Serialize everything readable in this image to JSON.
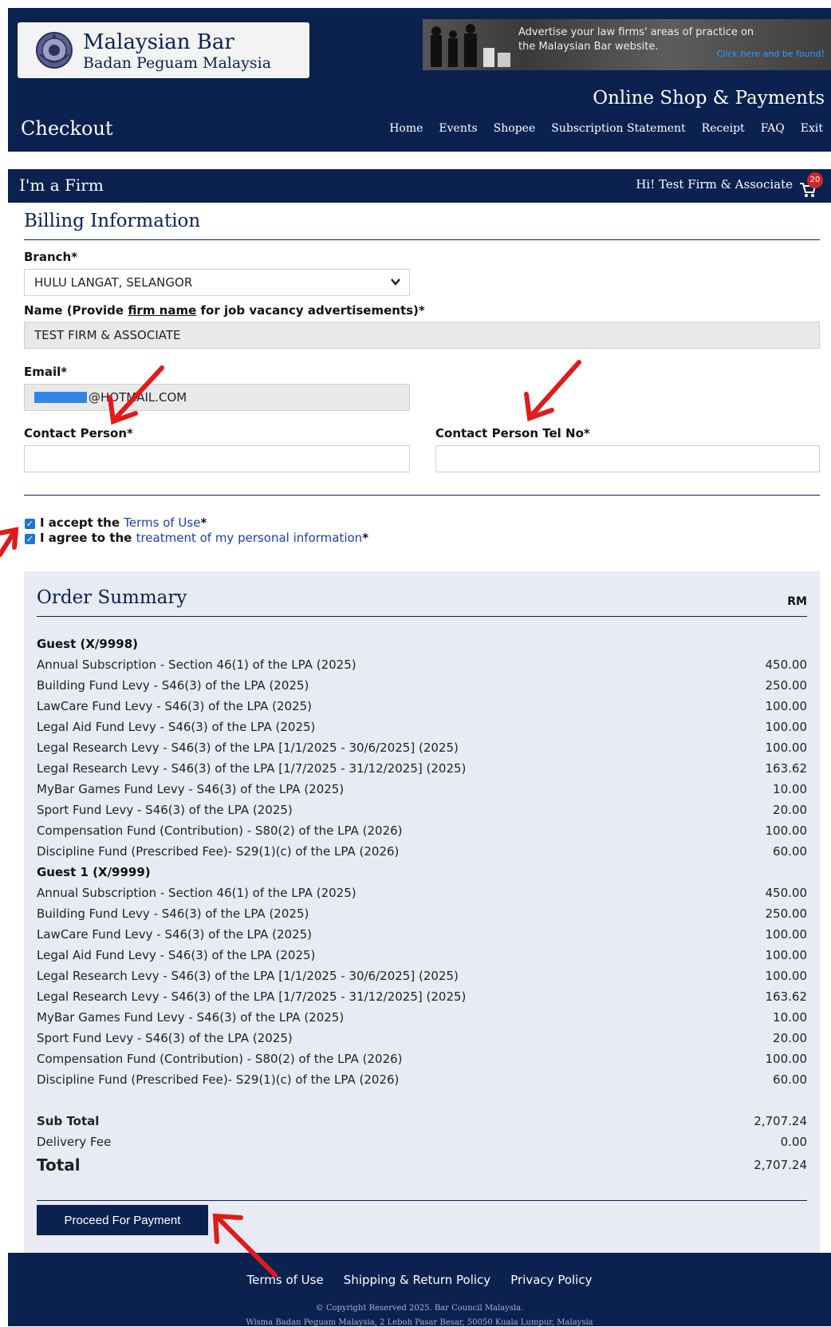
{
  "header": {
    "org_name": "Malaysian Bar",
    "org_name_sub": "Badan Peguam Malaysia",
    "ad_text": "Advertise your law firms' areas of practice on the Malaysian Bar website.",
    "ad_cta": "Click here and be found!",
    "shop_title": "Online Shop & Payments",
    "page_title": "Checkout",
    "nav": [
      "Home",
      "Events",
      "Shopee",
      "Subscription Statement",
      "Receipt",
      "FAQ",
      "Exit"
    ]
  },
  "firm_bar": {
    "label": "I'm a Firm",
    "greeting": "Hi! Test Firm & Associate",
    "cart_count": "20"
  },
  "billing": {
    "title": "Billing Information",
    "branch_label": "Branch*",
    "branch_value": "HULU LANGAT, SELANGOR",
    "name_label_pre": "Name (Provide ",
    "name_label_link": "firm name",
    "name_label_post": " for job vacancy advertisements)*",
    "name_value": "TEST FIRM & ASSOCIATE",
    "email_label": "Email*",
    "email_value": "@HOTMAIL.COM",
    "contact_label": "Contact Person*",
    "contact_value": "",
    "contact_tel_label": "Contact Person Tel No*",
    "contact_tel_value": ""
  },
  "consent": {
    "terms_pre": "I accept the ",
    "terms_link": "Terms of Use",
    "terms_post": "*",
    "privacy_pre": "I agree to the ",
    "privacy_link": "treatment of my personal information",
    "privacy_post": "*",
    "terms_checked": true,
    "privacy_checked": true
  },
  "summary": {
    "title": "Order Summary",
    "currency": "RM",
    "groups": [
      {
        "name": "Guest (X/9998)",
        "items": [
          {
            "desc": "Annual Subscription - Section 46(1) of the LPA (2025)",
            "amount": "450.00"
          },
          {
            "desc": "Building Fund Levy - S46(3) of the LPA (2025)",
            "amount": "250.00"
          },
          {
            "desc": "LawCare Fund Levy - S46(3) of the LPA (2025)",
            "amount": "100.00"
          },
          {
            "desc": "Legal Aid Fund Levy - S46(3) of the LPA (2025)",
            "amount": "100.00"
          },
          {
            "desc": "Legal Research Levy - S46(3) of the LPA [1/1/2025 - 30/6/2025] (2025)",
            "amount": "100.00"
          },
          {
            "desc": "Legal Research Levy - S46(3) of the LPA [1/7/2025 - 31/12/2025] (2025)",
            "amount": "163.62"
          },
          {
            "desc": "MyBar Games Fund Levy - S46(3) of the LPA (2025)",
            "amount": "10.00"
          },
          {
            "desc": "Sport Fund Levy - S46(3) of the LPA (2025)",
            "amount": "20.00"
          },
          {
            "desc": "Compensation Fund (Contribution) - S80(2) of the LPA (2026)",
            "amount": "100.00"
          },
          {
            "desc": "Discipline Fund (Prescribed Fee)- S29(1)(c) of the LPA (2026)",
            "amount": "60.00"
          }
        ]
      },
      {
        "name": "Guest 1 (X/9999)",
        "items": [
          {
            "desc": "Annual Subscription - Section 46(1) of the LPA (2025)",
            "amount": "450.00"
          },
          {
            "desc": "Building Fund Levy - S46(3) of the LPA (2025)",
            "amount": "250.00"
          },
          {
            "desc": "LawCare Fund Levy - S46(3) of the LPA (2025)",
            "amount": "100.00"
          },
          {
            "desc": "Legal Aid Fund Levy - S46(3) of the LPA (2025)",
            "amount": "100.00"
          },
          {
            "desc": "Legal Research Levy - S46(3) of the LPA [1/1/2025 - 30/6/2025] (2025)",
            "amount": "100.00"
          },
          {
            "desc": "Legal Research Levy - S46(3) of the LPA [1/7/2025 - 31/12/2025] (2025)",
            "amount": "163.62"
          },
          {
            "desc": "MyBar Games Fund Levy - S46(3) of the LPA (2025)",
            "amount": "10.00"
          },
          {
            "desc": "Sport Fund Levy - S46(3) of the LPA (2025)",
            "amount": "20.00"
          },
          {
            "desc": "Compensation Fund (Contribution) - S80(2) of the LPA (2026)",
            "amount": "100.00"
          },
          {
            "desc": "Discipline Fund (Prescribed Fee)- S29(1)(c) of the LPA (2026)",
            "amount": "60.00"
          }
        ]
      }
    ],
    "subtotal_label": "Sub Total",
    "subtotal_value": "2,707.24",
    "delivery_label": "Delivery Fee",
    "delivery_value": "0.00",
    "total_label": "Total",
    "total_value": "2,707.24",
    "pay_button": "Proceed For Payment"
  },
  "footer": {
    "links": [
      "Terms of Use",
      "Shipping & Return Policy",
      "Privacy Policy"
    ],
    "copyright": "© Copyright Reserved 2025. Bar Council Malaysia.",
    "address": "Wisma Badan Peguam Malaysia, 2 Leboh Pasar Besar, 50050 Kuala Lumpur, Malaysia"
  },
  "colors": {
    "navy": "#0b2150",
    "summary_bg": "#e8ebf3",
    "annotation_arrow": "#e11a1a",
    "link": "#1a3fb0"
  }
}
